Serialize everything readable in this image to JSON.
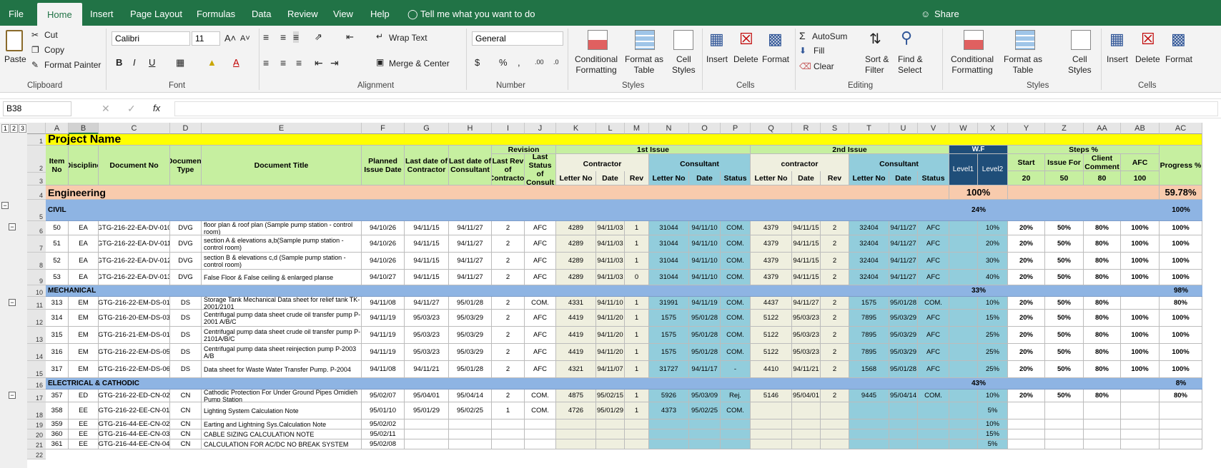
{
  "ribbon_tabs": [
    "File",
    "Home",
    "Insert",
    "Page Layout",
    "Formulas",
    "Data",
    "Review",
    "View",
    "Help"
  ],
  "tell_me": "Tell me what you want to do",
  "share": "Share",
  "clipboard": {
    "paste": "Paste",
    "cut": "Cut",
    "copy": "Copy",
    "format_painter": "Format Painter",
    "group": "Clipboard"
  },
  "font": {
    "name": "Calibri",
    "size": "11",
    "group": "Font",
    "bold": "B",
    "italic": "I",
    "underline": "U"
  },
  "alignment": {
    "wrap": "Wrap Text",
    "merge": "Merge & Center",
    "group": "Alignment"
  },
  "number": {
    "format": "General",
    "currency": "$",
    "percent": "%",
    "comma": ",",
    "group": "Number"
  },
  "styles": {
    "cond": [
      "Conditional",
      "Formatting"
    ],
    "table": [
      "Format as",
      "Table"
    ],
    "cell": [
      "Cell",
      "Styles"
    ],
    "group": "Styles"
  },
  "cells": {
    "insert": "Insert",
    "delete": "Delete",
    "format": "Format",
    "group": "Cells"
  },
  "editing": {
    "autosum": "AutoSum",
    "fill": "Fill",
    "clear": "Clear",
    "sort": [
      "Sort &",
      "Filter"
    ],
    "find": [
      "Find &",
      "Select"
    ],
    "group": "Editing"
  },
  "name_box": "B38",
  "fx": "fx",
  "outline_levels": [
    "1",
    "2",
    "3"
  ],
  "columns": [
    "A",
    "B",
    "C",
    "D",
    "E",
    "F",
    "G",
    "H",
    "I",
    "J",
    "K",
    "L",
    "M",
    "N",
    "O",
    "P",
    "Q",
    "R",
    "S",
    "T",
    "U",
    "V",
    "W",
    "X",
    "Y",
    "Z",
    "AA",
    "AB",
    "AC"
  ],
  "row_numbers": [
    "1",
    "2",
    "3",
    "4",
    "5",
    "6",
    "7",
    "8",
    "9",
    "10",
    "11",
    "12",
    "13",
    "14",
    "15",
    "16",
    "17",
    "18",
    "19",
    "20",
    "21",
    "22"
  ],
  "sheet": {
    "project_name": "Project Name",
    "headers": {
      "item_no": "Item No",
      "discipline": "Discipline",
      "doc_no": "Document No",
      "doc_type": "Document Type",
      "doc_title": "Document Title",
      "planned": "Planned Issue Date",
      "last_contractor": "Last date of Contractor",
      "last_consultant": "Last date of Consultant",
      "revision": "Revision",
      "last_rev": "Last Rev of Contractor",
      "last_status": "Last Status of Consult",
      "first_issue": "1st Issue",
      "second_issue": "2nd Issue",
      "contractor": "Contractor",
      "contractor2": "contractor",
      "consultant": "Consultant",
      "letter_no": "Letter No",
      "date": "Date",
      "rev": "Rev",
      "status": "Status",
      "wf": "W.F",
      "level1": "Level1",
      "level2": "Level2",
      "steps": "Steps %",
      "start": "Start",
      "issue_for": "Issue For",
      "client_comment": "Client Comment",
      "afc": "AFC",
      "progress": "Progress %",
      "w_start": "20",
      "w_issue": "50",
      "w_client": "80",
      "w_afc": "100"
    },
    "engineering": {
      "label": "Engineering",
      "wf": "100%",
      "progress": "59.78%"
    },
    "sections": [
      {
        "name": "CIVIL",
        "wf": "24%",
        "progress": "100%"
      },
      {
        "name": "MECHANICAL",
        "wf": "33%",
        "progress": "98%"
      },
      {
        "name": "ELECTRICAL & CATHODIC",
        "wf": "43%",
        "progress": "8%"
      }
    ],
    "rows": [
      [
        "50",
        "EA",
        "GTG-216-22-EA-DV-010",
        "DVG",
        "floor plan & roof plan (Sample pump station - control room)",
        "94/10/26",
        "94/11/15",
        "94/11/27",
        "2",
        "AFC",
        "4289",
        "94/11/03",
        "1",
        "31044",
        "94/11/10",
        "COM.",
        "4379",
        "94/11/15",
        "2",
        "32404",
        "94/11/27",
        "AFC",
        "10%",
        "20%",
        "50%",
        "80%",
        "100%",
        "100%"
      ],
      [
        "51",
        "EA",
        "GTG-216-22-EA-DV-011",
        "DVG",
        "section A & elevations a,b(Sample pump station - control room)",
        "94/10/26",
        "94/11/15",
        "94/11/27",
        "2",
        "AFC",
        "4289",
        "94/11/03",
        "1",
        "31044",
        "94/11/10",
        "COM.",
        "4379",
        "94/11/15",
        "2",
        "32404",
        "94/11/27",
        "AFC",
        "20%",
        "20%",
        "50%",
        "80%",
        "100%",
        "100%"
      ],
      [
        "52",
        "EA",
        "GTG-216-22-EA-DV-012",
        "DVG",
        "section B & elevations c,d (Sample pump station - control room)",
        "94/10/26",
        "94/11/15",
        "94/11/27",
        "2",
        "AFC",
        "4289",
        "94/11/03",
        "1",
        "31044",
        "94/11/10",
        "COM.",
        "4379",
        "94/11/15",
        "2",
        "32404",
        "94/11/27",
        "AFC",
        "30%",
        "20%",
        "50%",
        "80%",
        "100%",
        "100%"
      ],
      [
        "53",
        "EA",
        "GTG-216-22-EA-DV-013",
        "DVG",
        "False Floor & False ceiling & enlarged planse",
        "94/10/27",
        "94/11/15",
        "94/11/27",
        "2",
        "AFC",
        "4289",
        "94/11/03",
        "0",
        "31044",
        "94/11/10",
        "COM.",
        "4379",
        "94/11/15",
        "2",
        "32404",
        "94/11/27",
        "AFC",
        "40%",
        "20%",
        "50%",
        "80%",
        "100%",
        "100%"
      ],
      [
        "313",
        "EM",
        "GTG-216-22-EM-DS-01",
        "DS",
        "Storage Tank Mechanical Data sheet for relief tank TK-2001/2101",
        "94/11/08",
        "94/11/27",
        "95/01/28",
        "2",
        "COM.",
        "4331",
        "94/11/10",
        "1",
        "31991",
        "94/11/19",
        "COM.",
        "4437",
        "94/11/27",
        "2",
        "1575",
        "95/01/28",
        "COM.",
        "10%",
        "20%",
        "50%",
        "80%",
        "",
        "80%"
      ],
      [
        "314",
        "EM",
        "GTG-216-20-EM-DS-03",
        "DS",
        "Centrifugal pump data sheet  crude oil transfer pump P-2001 A/B/C",
        "94/11/19",
        "95/03/23",
        "95/03/29",
        "2",
        "AFC",
        "4419",
        "94/11/20",
        "1",
        "1575",
        "95/01/28",
        "COM.",
        "5122",
        "95/03/23",
        "2",
        "7895",
        "95/03/29",
        "AFC",
        "15%",
        "20%",
        "50%",
        "80%",
        "100%",
        "100%"
      ],
      [
        "315",
        "EM",
        "GTG-216-21-EM-DS-01",
        "DS",
        "Centrifugal pump data sheet  crude oil transfer pump P-2101A/B/C",
        "94/11/19",
        "95/03/23",
        "95/03/29",
        "2",
        "AFC",
        "4419",
        "94/11/20",
        "1",
        "1575",
        "95/01/28",
        "COM.",
        "5122",
        "95/03/23",
        "2",
        "7895",
        "95/03/29",
        "AFC",
        "25%",
        "20%",
        "50%",
        "80%",
        "100%",
        "100%"
      ],
      [
        "316",
        "EM",
        "GTG-216-22-EM-DS-05",
        "DS",
        " Centrifugal pump data sheet  reinjection pump P-2003 A/B",
        "94/11/19",
        "95/03/23",
        "95/03/29",
        "2",
        "AFC",
        "4419",
        "94/11/20",
        "1",
        "1575",
        "95/01/28",
        "COM.",
        "5122",
        "95/03/23",
        "2",
        "7895",
        "95/03/29",
        "AFC",
        "25%",
        "20%",
        "50%",
        "80%",
        "100%",
        "100%"
      ],
      [
        "317",
        "EM",
        "GTG-216-22-EM-DS-06",
        "DS",
        "Data sheet for Waste Water Transfer Pump. P-2004",
        "94/11/08",
        "94/11/21",
        "95/01/28",
        "2",
        "AFC",
        "4321",
        "94/11/07",
        "1",
        "31727",
        "94/11/17",
        "-",
        "4410",
        "94/11/21",
        "2",
        "1568",
        "95/01/28",
        "AFC",
        "25%",
        "20%",
        "50%",
        "80%",
        "100%",
        "100%"
      ],
      [
        "357",
        "ED",
        "GTG-216-22-ED-CN-02",
        "CN",
        "Cathodic Protection For Under Ground Pipes Omidieh Pump Station",
        "95/02/07",
        "95/04/01",
        "95/04/14",
        "2",
        "COM.",
        "4875",
        "95/02/15",
        "1",
        "5926",
        "95/03/09",
        "Rej.",
        "5146",
        "95/04/01",
        "2",
        "9445",
        "95/04/14",
        "COM.",
        "10%",
        "20%",
        "50%",
        "80%",
        "",
        "80%"
      ],
      [
        "358",
        "EE",
        "GTG-216-22-EE-CN-01",
        "CN",
        "Lighting System Calculation Note",
        "95/01/10",
        "95/01/29",
        "95/02/25",
        "1",
        "COM.",
        "4726",
        "95/01/29",
        "1",
        "4373",
        "95/02/25",
        "COM.",
        "",
        "",
        "",
        "",
        "",
        "",
        "5%",
        "",
        "",
        "",
        "",
        ""
      ],
      [
        "359",
        "EE",
        "GTG-216-44-EE-CN-02",
        "CN",
        "Earting and Lightning Sys.Calculation Note",
        "95/02/02",
        "",
        "",
        "",
        "",
        "",
        "",
        "",
        "",
        "",
        "",
        "",
        "",
        "",
        "",
        "",
        "",
        "10%",
        "",
        "",
        "",
        "",
        ""
      ],
      [
        "360",
        "EE",
        "GTG-216-44-EE-CN-03",
        "CN",
        "CABLE SIZING CALCULATION NOTE",
        "95/02/11",
        "",
        "",
        "",
        "",
        "",
        "",
        "",
        "",
        "",
        "",
        "",
        "",
        "",
        "",
        "",
        "",
        "15%",
        "",
        "",
        "",
        "",
        ""
      ],
      [
        "361",
        "EE",
        "GTG-216-44-EE-CN-04",
        "CN",
        "CALCULATION FOR AC/DC NO BREAK SYSTEM",
        "95/02/08",
        "",
        "",
        "",
        "",
        "",
        "",
        "",
        "",
        "",
        "",
        "",
        "",
        "",
        "",
        "",
        "",
        "5%",
        "",
        "",
        "",
        "",
        ""
      ]
    ]
  }
}
